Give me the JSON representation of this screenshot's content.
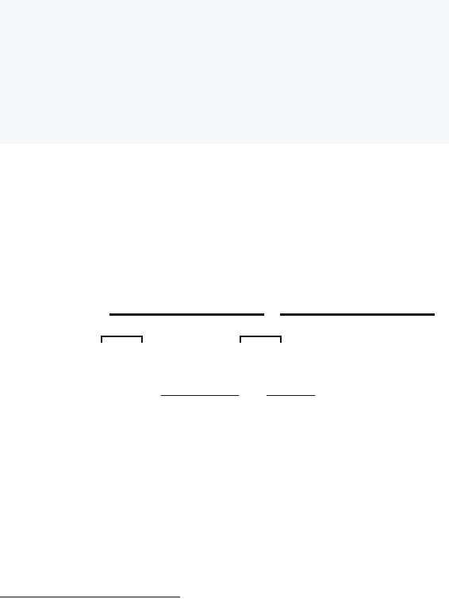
{
  "page": {
    "background": "#ffffff",
    "header_band_color": "#f6f7f9",
    "ink_color": "#111111"
  }
}
